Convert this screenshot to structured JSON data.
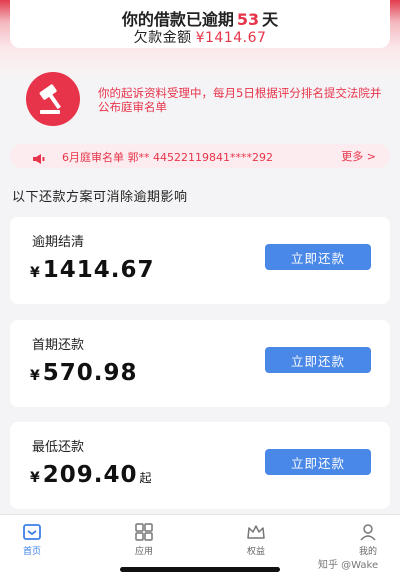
{
  "header": {
    "overdue_prefix": "你的借款已逾期",
    "overdue_days": "53",
    "overdue_unit": "天",
    "debt_label": "欠款金额",
    "debt_amount": "¥1414.67"
  },
  "notice": {
    "text": "你的起诉资料受理中，每月5日根据评分排名提交法院并公布庭审名单"
  },
  "ticker": {
    "text": "6月庭审名单 郭** 44522119841****292",
    "more_label": "更多 >"
  },
  "section": {
    "title": "以下还款方案可消除逾期影响"
  },
  "plans": [
    {
      "label": "逾期结清",
      "currency": "¥",
      "amount": "1414.67",
      "suffix": "",
      "button": "立即还款"
    },
    {
      "label": "首期还款",
      "currency": "¥",
      "amount": "570.98",
      "suffix": "",
      "button": "立即还款"
    },
    {
      "label": "最低还款",
      "currency": "¥",
      "amount": "209.40",
      "suffix": "起",
      "button": "立即还款"
    }
  ],
  "tabs": [
    {
      "label": "首页",
      "icon": "home-icon",
      "active": true
    },
    {
      "label": "应用",
      "icon": "apps-grid-icon",
      "active": false
    },
    {
      "label": "权益",
      "icon": "crown-icon",
      "active": false
    },
    {
      "label": "我的",
      "icon": "profile-icon",
      "active": false
    }
  ],
  "watermark": "知乎 @Wake",
  "colors": {
    "accent_red": "#e8344a",
    "button_blue": "#4a88e8",
    "tab_active": "#3d7fe6"
  }
}
